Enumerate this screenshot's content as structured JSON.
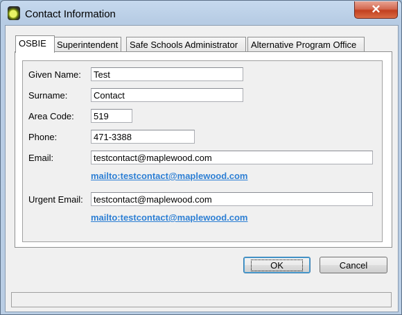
{
  "window": {
    "title": "Contact Information",
    "close_glyph": "✕"
  },
  "tabs": [
    {
      "label": "OSBIE",
      "active": true
    },
    {
      "label": "Superintendent",
      "active": false
    },
    {
      "label": "Safe Schools Administrator",
      "active": false
    },
    {
      "label": "Alternative Program Office",
      "active": false
    }
  ],
  "form": {
    "given_name": {
      "label": "Given Name:",
      "value": "Test"
    },
    "surname": {
      "label": "Surname:",
      "value": "Contact"
    },
    "area_code": {
      "label": "Area Code:",
      "value": "519"
    },
    "phone": {
      "label": "Phone:",
      "value": "471-3388"
    },
    "email": {
      "label": "Email:",
      "value": "testcontact@maplewood.com",
      "link": "mailto:testcontact@maplewood.com"
    },
    "urgent_email": {
      "label": "Urgent Email:",
      "value": "testcontact@maplewood.com",
      "link": "mailto:testcontact@maplewood.com"
    }
  },
  "buttons": {
    "ok": "OK",
    "cancel": "Cancel"
  },
  "status": ""
}
